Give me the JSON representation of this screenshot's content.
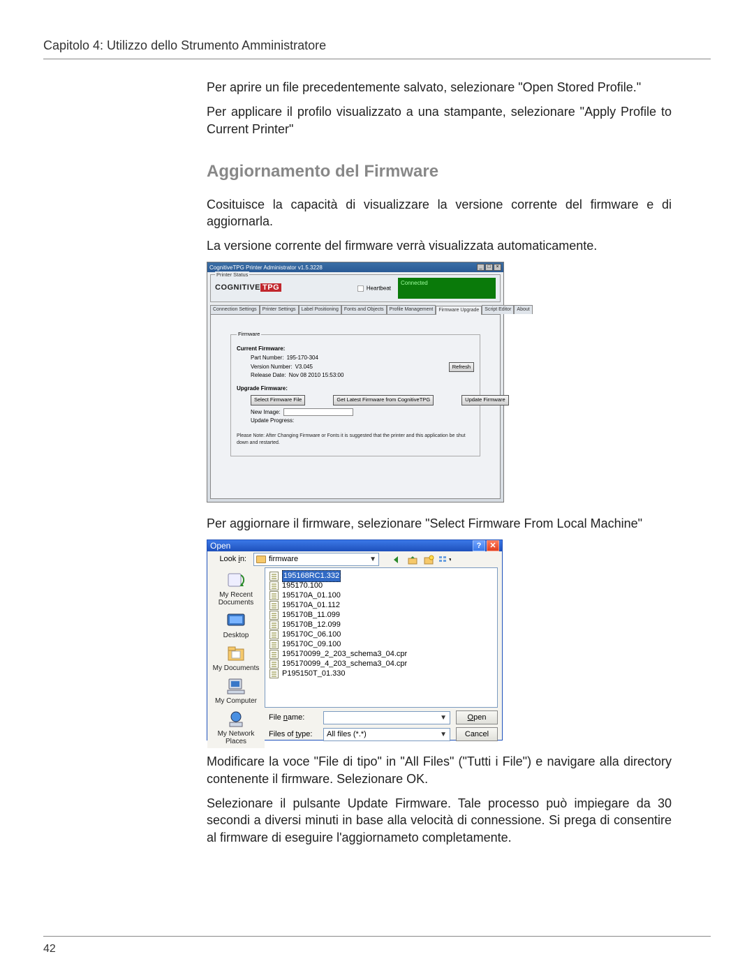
{
  "page": {
    "chapter_header": "Capitolo 4: Utilizzo dello Strumento Amministratore",
    "page_number": "42"
  },
  "text": {
    "p1": "Per aprire un file precedentemente salvato, selezionare \"Open Stored Profile.\"",
    "p2": "Per applicare il profilo visualizzato a una stampante, selezionare \"Apply Profile to Current Printer\"",
    "section_title": "Aggiornamento del Firmware",
    "p3": "Cosituisce la capacità di visualizzare la versione corrente del firmware e di aggiornarla.",
    "p4": "La versione corrente del firmware verrà visualizzata automaticamente.",
    "p5": "Per aggiornare il firmware, selezionare \"Select Firmware From Local Machine\"",
    "p6": "Modificare  la voce \"File di tipo\" in \"All Files\" (\"Tutti i File\") e navigare alla directory contenente il firmware. Selezionare OK.",
    "p7": "Selezionare il pulsante Update Firmware. Tale processo può impiegare da 30 secondi a diversi minuti in base alla velocità di connessione. Si prega di consentire al firmware di eseguire l'aggiornameto completamente."
  },
  "scr1": {
    "title": "CognitiveTPG Printer Administrator v1.5.3228",
    "status_label": "Printer Status",
    "logo_left": "COGNITIVE",
    "logo_right": "TPG",
    "heartbeat": "Heartbeat",
    "connected": "Connected",
    "tabs": {
      "t1": "Connection Settings",
      "t2": "Printer Settings",
      "t3": "Label Positioning",
      "t4": "Fonts and Objects",
      "t5": "Profile Management",
      "t6": "Firmware Upgrade",
      "t7": "Script Editor",
      "t8": "About"
    },
    "fw": {
      "group_label": "Firmware",
      "current_head": "Current Firmware:",
      "part_label": "Part Number:",
      "part_value": "195-170-304",
      "ver_label": "Version Number:",
      "ver_value": "V3.045",
      "rel_label": "Release Date:",
      "rel_value": "Nov 08 2010 15:53:00",
      "refresh_btn": "Refresh",
      "upgrade_head": "Upgrade Firmware:",
      "select_btn": "Select Firmware File",
      "get_btn": "Get Latest Firmware from CognitiveTPG",
      "update_btn": "Update Firmware",
      "new_image": "New Image:",
      "progress": "Update Progress:",
      "note": "Please Note: After Changing Firmware or Fonts it is suggested that the printer and this application be shut down and restarted."
    }
  },
  "scr2": {
    "title": "Open",
    "lookin_label_pre": "Look ",
    "lookin_label_key": "i",
    "lookin_label_post": "n:",
    "folder": "firmware",
    "places": {
      "recent": "My Recent Documents",
      "desktop": "Desktop",
      "mydocs": "My Documents",
      "mycomp": "My Computer",
      "mynet": "My Network Places"
    },
    "files": [
      "195168RC1.332",
      "195170.100",
      "195170A_01.100",
      "195170A_01.112",
      "195170B_11.099",
      "195170B_12.099",
      "195170C_06.100",
      "195170C_09.100",
      "195170099_2_203_schema3_04.cpr",
      "195170099_4_203_schema3_04.cpr",
      "P195150T_01.330"
    ],
    "filename_label_pre": "File ",
    "filename_label_key": "n",
    "filename_label_post": "ame:",
    "filename_value": "",
    "filetype_label_pre": "Files of ",
    "filetype_label_key": "t",
    "filetype_label_post": "ype:",
    "filetype_value": "All files (*.*)",
    "open_btn_key": "O",
    "open_btn_post": "pen",
    "cancel_btn": "Cancel"
  }
}
